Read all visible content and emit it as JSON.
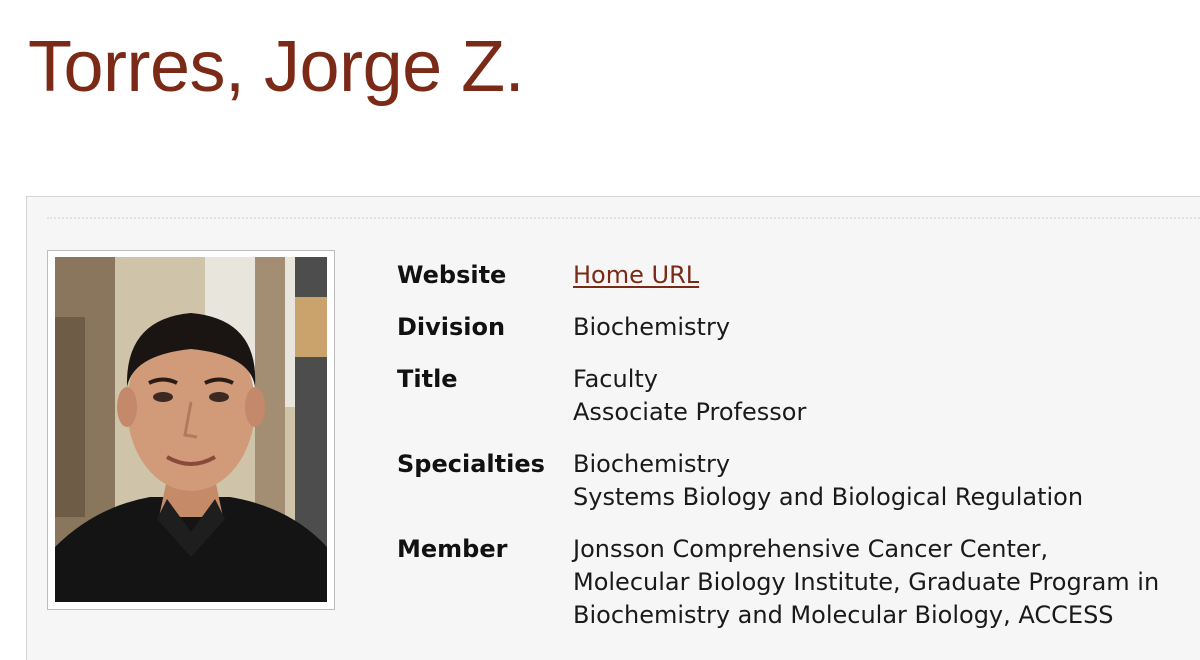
{
  "page": {
    "title": "Torres, Jorge Z."
  },
  "profile": {
    "photo_alt": "Photo of Jorge Z. Torres",
    "rows": [
      {
        "label": "Website",
        "values": [
          "Home URL"
        ]
      },
      {
        "label": "Division",
        "values": [
          "Biochemistry"
        ]
      },
      {
        "label": "Title",
        "values": [
          "Faculty",
          "Associate Professor"
        ]
      },
      {
        "label": "Specialties",
        "values": [
          "Biochemistry",
          "Systems Biology and Biological Regulation"
        ]
      },
      {
        "label": "Member",
        "values": [
          "Jonsson Comprehensive Cancer Center,",
          "Molecular Biology Institute, Graduate Program in",
          "Biochemistry and Molecular Biology, ACCESS"
        ]
      }
    ]
  },
  "colors": {
    "title": "#7a2a16",
    "link": "#7a2a16",
    "panel_background": "#f6f6f6"
  }
}
